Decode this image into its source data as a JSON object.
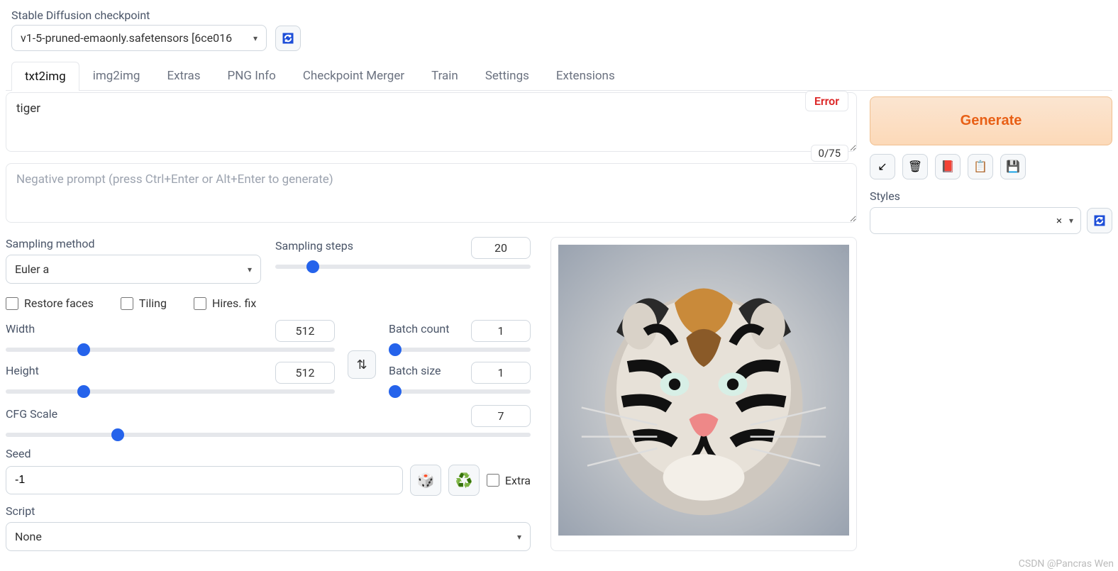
{
  "checkpoint": {
    "label": "Stable Diffusion checkpoint",
    "value": "v1-5-pruned-emaonly.safetensors [6ce016"
  },
  "tabs": [
    "txt2img",
    "img2img",
    "Extras",
    "PNG Info",
    "Checkpoint Merger",
    "Train",
    "Settings",
    "Extensions"
  ],
  "active_tab": "txt2img",
  "prompt": {
    "value": "tiger",
    "error_label": "Error",
    "counter": "0/75"
  },
  "neg_prompt": {
    "placeholder": "Negative prompt (press Ctrl+Enter or Alt+Enter to generate)"
  },
  "generate_label": "Generate",
  "styles_label": "Styles",
  "sampling": {
    "method_label": "Sampling method",
    "method_value": "Euler a",
    "steps_label": "Sampling steps",
    "steps_value": "20"
  },
  "checks": {
    "restore": "Restore faces",
    "tiling": "Tiling",
    "hires": "Hires. fix"
  },
  "dims": {
    "width_label": "Width",
    "width_value": "512",
    "height_label": "Height",
    "height_value": "512",
    "batch_count_label": "Batch count",
    "batch_count_value": "1",
    "batch_size_label": "Batch size",
    "batch_size_value": "1"
  },
  "cfg": {
    "label": "CFG Scale",
    "value": "7"
  },
  "seed": {
    "label": "Seed",
    "value": "-1",
    "extra_label": "Extra"
  },
  "script": {
    "label": "Script",
    "value": "None"
  },
  "watermark": "CSDN @Pancras Wen"
}
